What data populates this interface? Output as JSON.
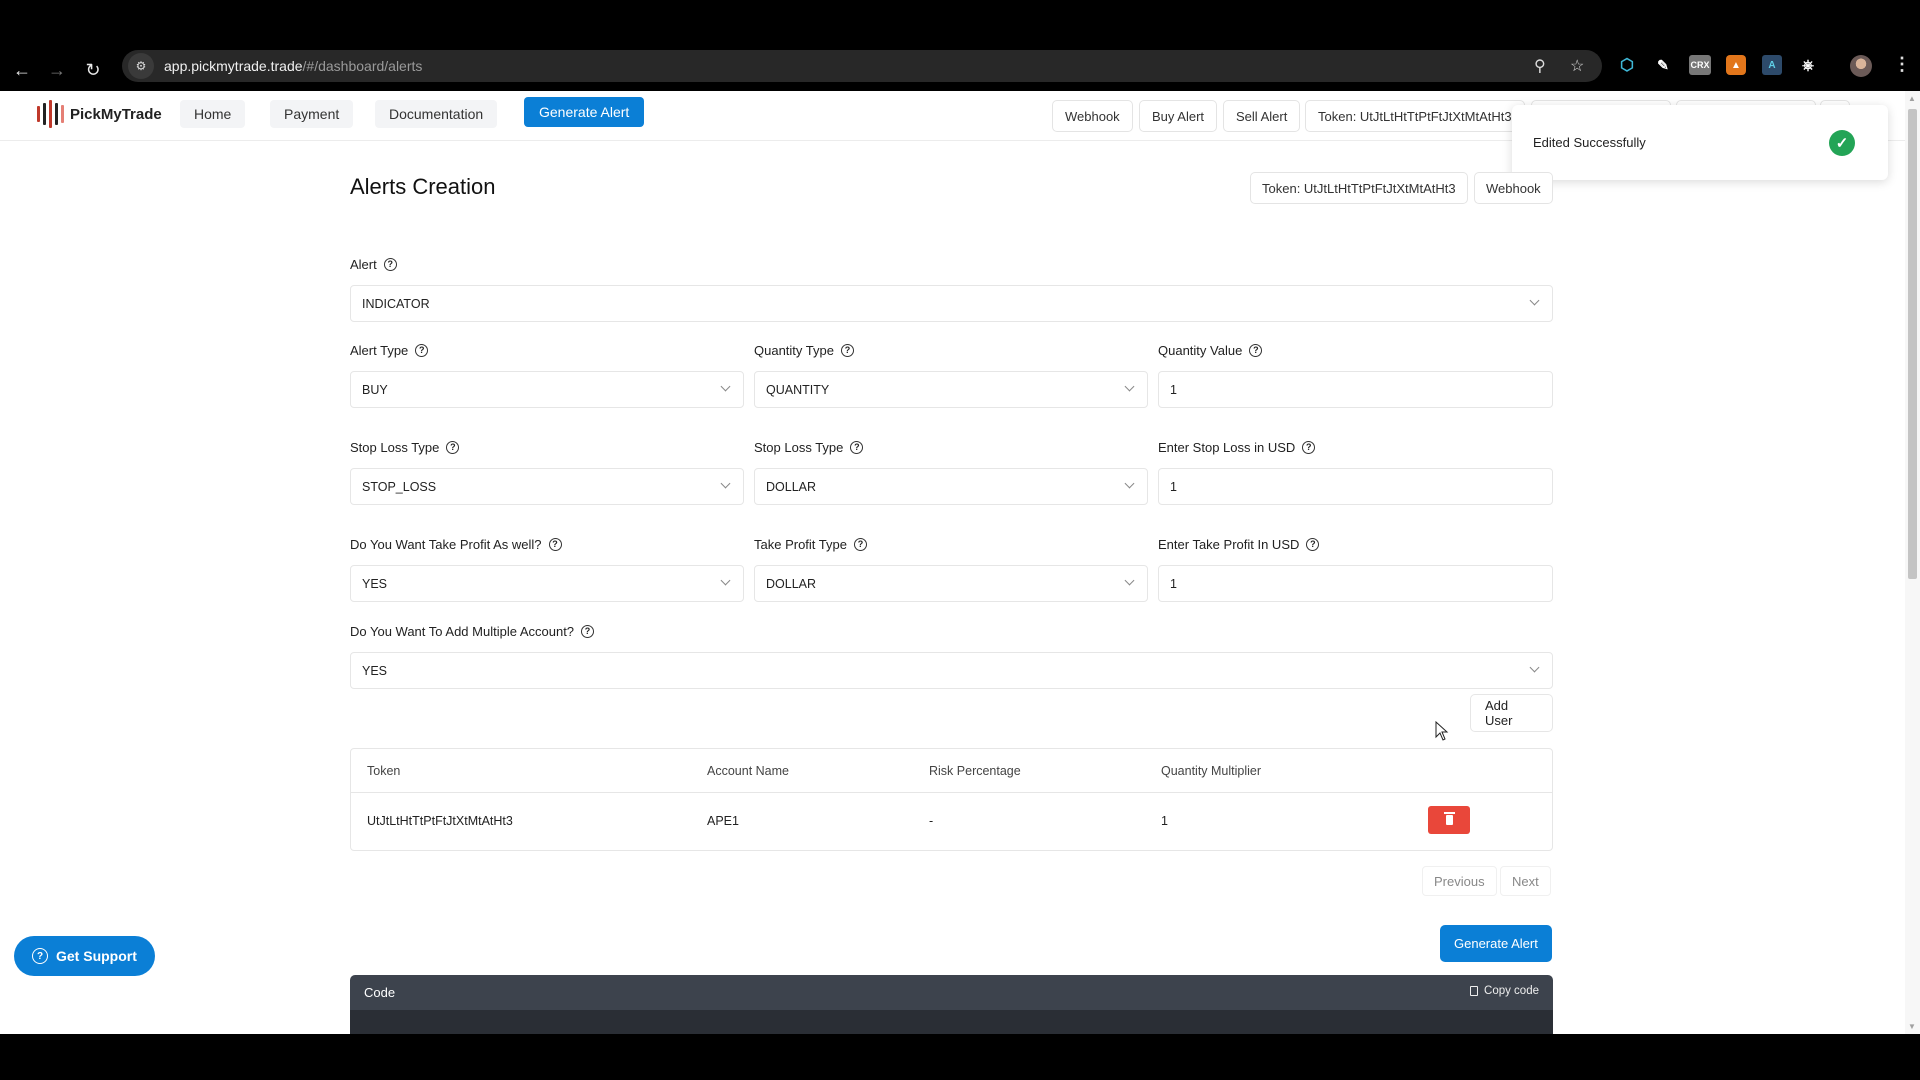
{
  "browser": {
    "url_host": "app.pickmytrade.trade",
    "url_path": "/#/dashboard/alerts",
    "back_icon": "arrow-left",
    "forward_icon": "arrow-right",
    "reload_icon": "reload",
    "extensions": [
      "web-extension",
      "broom-extension",
      "CRX",
      "metamask-extension",
      "compass-extension",
      "puzzle-extension"
    ],
    "crx_label": "CRX"
  },
  "nav": {
    "logo_text": "PickMyTrade",
    "links": [
      "Home",
      "Payment",
      "Documentation"
    ],
    "generate_alert": "Generate Alert",
    "right_buttons": [
      "Webhook",
      "Buy Alert",
      "Sell Alert",
      "Token: UtJtLtHtTtPtFtJtXtMtAtHt3"
    ]
  },
  "toast": {
    "message": "Edited Successfully",
    "status": "success",
    "color": "#23a456"
  },
  "page": {
    "title": "Alerts Creation",
    "token_button": "Token: UtJtLtHtTtPtFtJtXtMtAtHt3",
    "webhook_button": "Webhook"
  },
  "form": {
    "alert": {
      "label": "Alert",
      "value": "INDICATOR"
    },
    "alert_type": {
      "label": "Alert Type",
      "value": "BUY"
    },
    "quantity_type": {
      "label": "Quantity Type",
      "value": "QUANTITY"
    },
    "quantity_value": {
      "label": "Quantity Value",
      "value": "1"
    },
    "stop_loss_type": {
      "label": "Stop Loss Type",
      "value": "STOP_LOSS"
    },
    "stop_loss_type2": {
      "label": "Stop Loss Type",
      "value": "DOLLAR"
    },
    "stop_loss_usd": {
      "label": "Enter Stop Loss in USD",
      "value": "1"
    },
    "take_profit": {
      "label": "Do You Want Take Profit As well?",
      "value": "YES"
    },
    "take_profit_type": {
      "label": "Take Profit Type",
      "value": "DOLLAR"
    },
    "take_profit_usd": {
      "label": "Enter Take Profit In USD",
      "value": "1"
    },
    "multiple_account": {
      "label": "Do You Want To Add Multiple Account?",
      "value": "YES"
    }
  },
  "add_user": "Add User",
  "table": {
    "headers": [
      "Token",
      "Account Name",
      "Risk Percentage",
      "Quantity Multiplier"
    ],
    "rows": [
      {
        "token": "UtJtLtHtTtPtFtJtXtMtAtHt3",
        "account": "APE1",
        "risk": "-",
        "multiplier": "1"
      }
    ],
    "delete_color": "#e9473a"
  },
  "pagination": {
    "previous": "Previous",
    "next": "Next"
  },
  "generate_button": "Generate Alert",
  "code": {
    "title": "Code",
    "copy": "Copy code"
  },
  "support": {
    "label": "Get Support"
  },
  "colors": {
    "primary": "#0b7fd6",
    "code_header": "#3d434d",
    "code_body": "#2a2e35"
  }
}
